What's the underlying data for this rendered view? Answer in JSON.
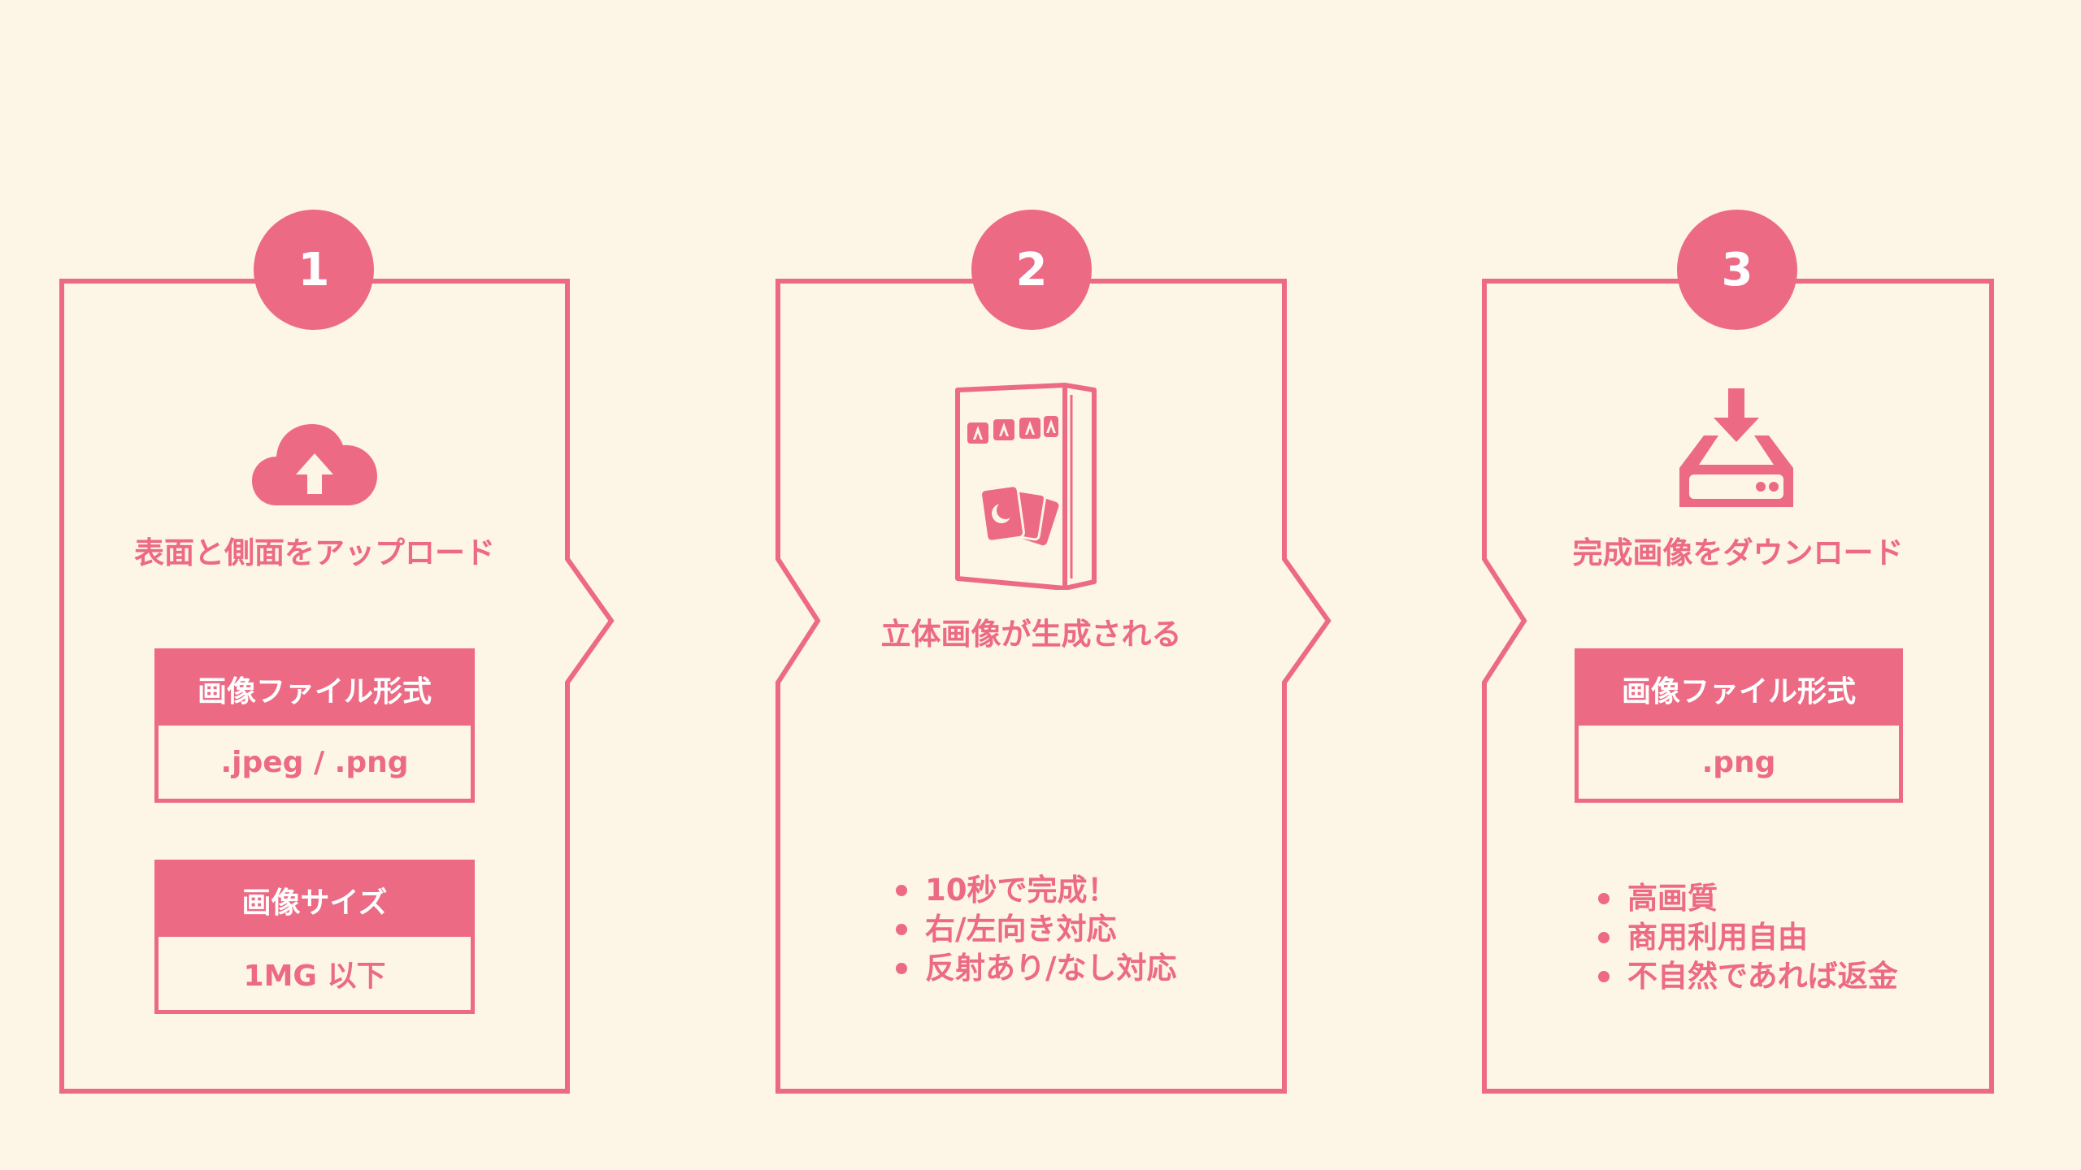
{
  "colors": {
    "background": "#fdf5e6",
    "accent": "#ec6a84",
    "white": "#ffffff"
  },
  "steps": [
    {
      "number": "1",
      "title": "表面と側面をアップロード",
      "icon": "cloud-upload-icon",
      "boxes": [
        {
          "header": "画像ファイル形式",
          "value": ".jpeg / .png"
        },
        {
          "header": "画像サイズ",
          "value": "1MG 以下"
        }
      ]
    },
    {
      "number": "2",
      "title": "立体画像が生成される",
      "icon": "card-box-icon",
      "bullets": [
        "10秒で完成！",
        "右/左向き対応",
        "反射あり/なし対応"
      ]
    },
    {
      "number": "3",
      "title": "完成画像をダウンロード",
      "icon": "download-drive-icon",
      "boxes": [
        {
          "header": "画像ファイル形式",
          "value": ".png"
        }
      ],
      "bullets": [
        "高画質",
        "商用利用自由",
        "不自然であれば返金"
      ]
    }
  ]
}
